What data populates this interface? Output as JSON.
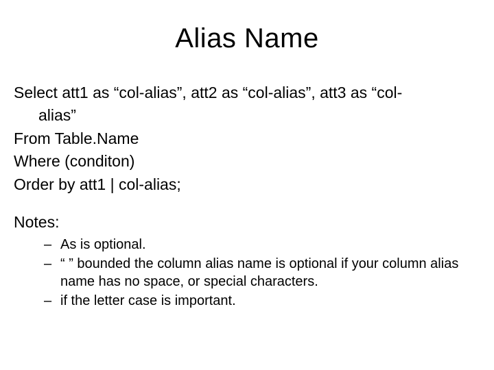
{
  "title": "Alias Name",
  "lines": {
    "l1": "Select att1 as “col-alias”, att2 as “col-alias”, att3 as “col-",
    "l1cont": "alias”",
    "l2": "From Table.Name",
    "l3": "Where (conditon)",
    "l4": "Order by att1 | col-alias;"
  },
  "notes_label": "Notes:",
  "notes": {
    "n1": "As is optional.",
    "n2": " “ ” bounded the column alias name is optional if your column alias name has no space, or special characters.",
    "n3": "if the letter case is important."
  }
}
